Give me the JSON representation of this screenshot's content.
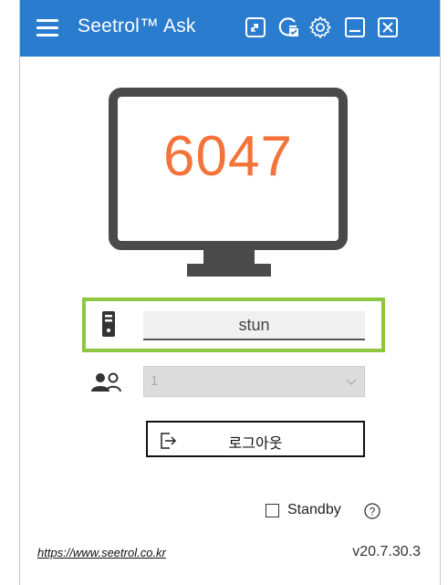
{
  "titlebar": {
    "title": "Seetrol™ Ask",
    "icons": [
      "menu-icon",
      "screen-share-icon",
      "refresh-check-icon",
      "gear-icon",
      "minimize-icon",
      "close-icon"
    ]
  },
  "monitor": {
    "id_number": "6047"
  },
  "server": {
    "value": "stun",
    "icon": "server-icon"
  },
  "user_select": {
    "value": "1",
    "icon": "users-icon"
  },
  "logout": {
    "label": "로그아웃",
    "icon": "logout-icon"
  },
  "standby": {
    "label": "Standby",
    "checked": false
  },
  "footer": {
    "link": "https://www.seetrol.co.kr",
    "version": "v20.7.30.3"
  },
  "colors": {
    "titlebar": "#2a7ccf",
    "id_number": "#f4733a",
    "highlight_border": "#8dc63f",
    "monitor": "#4a4a4a"
  }
}
